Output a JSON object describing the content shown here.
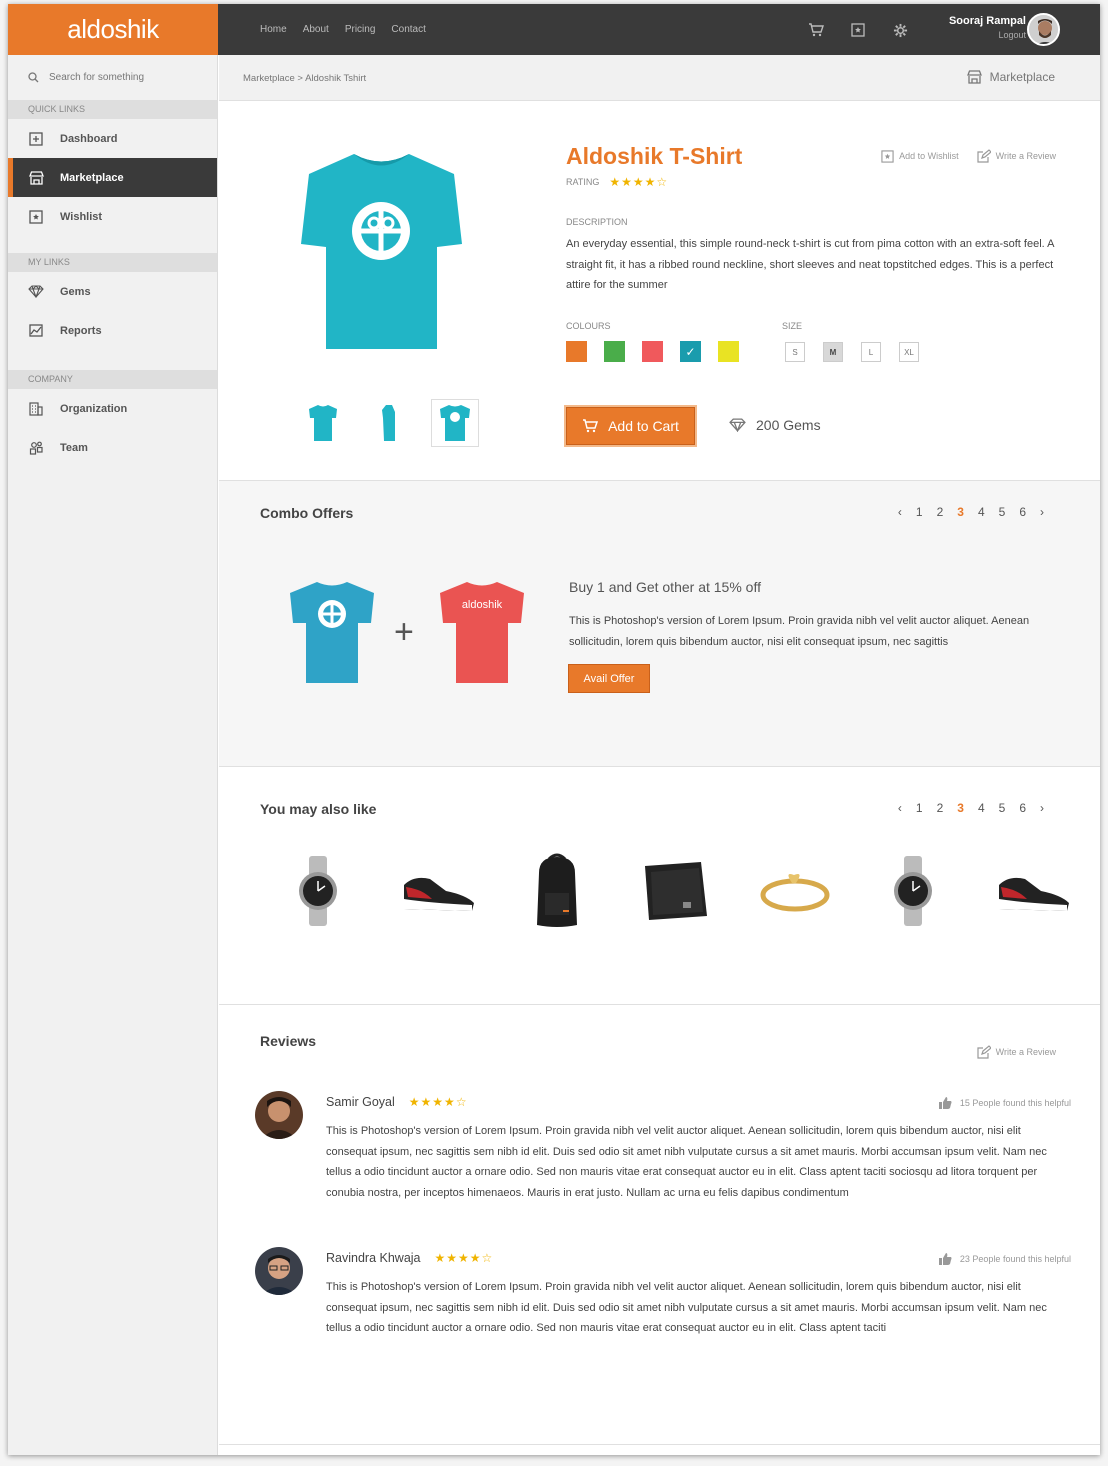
{
  "app": {
    "logo": "aldoshik"
  },
  "topnav": [
    "Home",
    "About",
    "Pricing",
    "Contact"
  ],
  "user": {
    "name": "Sooraj Rampal",
    "logout": "Logout"
  },
  "search": {
    "placeholder": "Search for something"
  },
  "sidebar": {
    "quick_links_label": "QUICK LINKS",
    "quick_links": [
      {
        "label": "Dashboard",
        "icon": "dashboard-icon"
      },
      {
        "label": "Marketplace",
        "icon": "store-icon"
      },
      {
        "label": "Wishlist",
        "icon": "wishlist-icon"
      }
    ],
    "my_links_label": "MY LINKS",
    "my_links": [
      {
        "label": "Gems",
        "icon": "gem-icon"
      },
      {
        "label": "Reports",
        "icon": "chart-icon"
      }
    ],
    "company_label": "COMPANY",
    "company": [
      {
        "label": "Organization",
        "icon": "building-icon"
      },
      {
        "label": "Team",
        "icon": "team-icon"
      }
    ]
  },
  "breadcrumb": {
    "parent": "Marketplace",
    "separator": ">",
    "current": "Aldoshik Tshirt",
    "right_label": "Marketplace"
  },
  "product": {
    "title": "Aldoshik T-Shirt",
    "rating_label": "RATING",
    "rating": 4,
    "stars": "★★★★☆",
    "add_wishlist": "Add to Wishlist",
    "write_review": "Write a Review",
    "description_label": "DESCRIPTION",
    "description": "An everyday essential, this simple round-neck t-shirt is cut from pima cotton with an extra-soft feel. A straight fit, it has a ribbed round neckline, short sleeves and neat topstitched edges. This is a perfect attire for the summer",
    "colours_label": "COLOURS",
    "colours": [
      "#e8792a",
      "#4aad4a",
      "#f0595c",
      "#1a9cad",
      "#e9e323"
    ],
    "selected_colour": "#1a9cad",
    "size_label": "SIZE",
    "sizes": [
      "S",
      "M",
      "L",
      "XL"
    ],
    "selected_size": "M",
    "add_to_cart": "Add to Cart",
    "gems": "200 Gems",
    "shirt_color": "#21b5c6"
  },
  "combo": {
    "title": "Combo Offers",
    "pages": [
      "1",
      "2",
      "3",
      "4",
      "5",
      "6"
    ],
    "current_page": "3",
    "plus": "+",
    "second_shirt_text": "aldoshik",
    "offer_heading": "Buy 1 and Get other at 15% off",
    "offer_text": "This is Photoshop's version  of Lorem Ipsum. Proin gravida nibh vel velit auctor aliquet. Aenean sollicitudin, lorem quis bibendum auctor, nisi elit consequat ipsum, nec sagittis",
    "button": "Avail Offer"
  },
  "also_like": {
    "title": "You may also like",
    "pages": [
      "1",
      "2",
      "3",
      "4",
      "5",
      "6"
    ],
    "current_page": "3",
    "items": [
      "watch-icon",
      "sneaker-icon",
      "backpack-icon",
      "wallet-icon",
      "ring-icon",
      "watch-icon",
      "sneaker-icon"
    ]
  },
  "reviews": {
    "title": "Reviews",
    "write_review": "Write a Review",
    "items": [
      {
        "name": "Samir Goyal",
        "stars": "★★★★☆",
        "rating": 4,
        "helpful": "15 People found this helpful",
        "text": "This is Photoshop's version  of Lorem Ipsum. Proin gravida nibh vel velit auctor aliquet. Aenean sollicitudin, lorem quis bibendum auctor, nisi elit consequat ipsum, nec sagittis sem nibh id elit. Duis sed odio sit amet nibh vulputate cursus a sit amet mauris. Morbi accumsan ipsum velit. Nam nec tellus a odio tincidunt auctor a ornare odio. Sed non  mauris vitae erat consequat auctor eu in elit. Class aptent taciti sociosqu ad litora torquent per conubia nostra, per inceptos himenaeos. Mauris in erat justo. Nullam ac urna eu felis dapibus condimentum"
      },
      {
        "name": "Ravindra Khwaja",
        "stars": "★★★★☆",
        "rating": 4,
        "helpful": "23 People found this helpful",
        "text": "This is Photoshop's version  of Lorem Ipsum. Proin gravida nibh vel velit auctor aliquet. Aenean sollicitudin, lorem quis bibendum auctor, nisi elit consequat ipsum, nec sagittis sem nibh id elit. Duis sed odio sit amet nibh vulputate cursus a sit amet mauris. Morbi accumsan ipsum velit. Nam nec tellus a odio tincidunt auctor a ornare odio. Sed non  mauris vitae erat consequat auctor eu in elit. Class aptent taciti"
      }
    ]
  }
}
